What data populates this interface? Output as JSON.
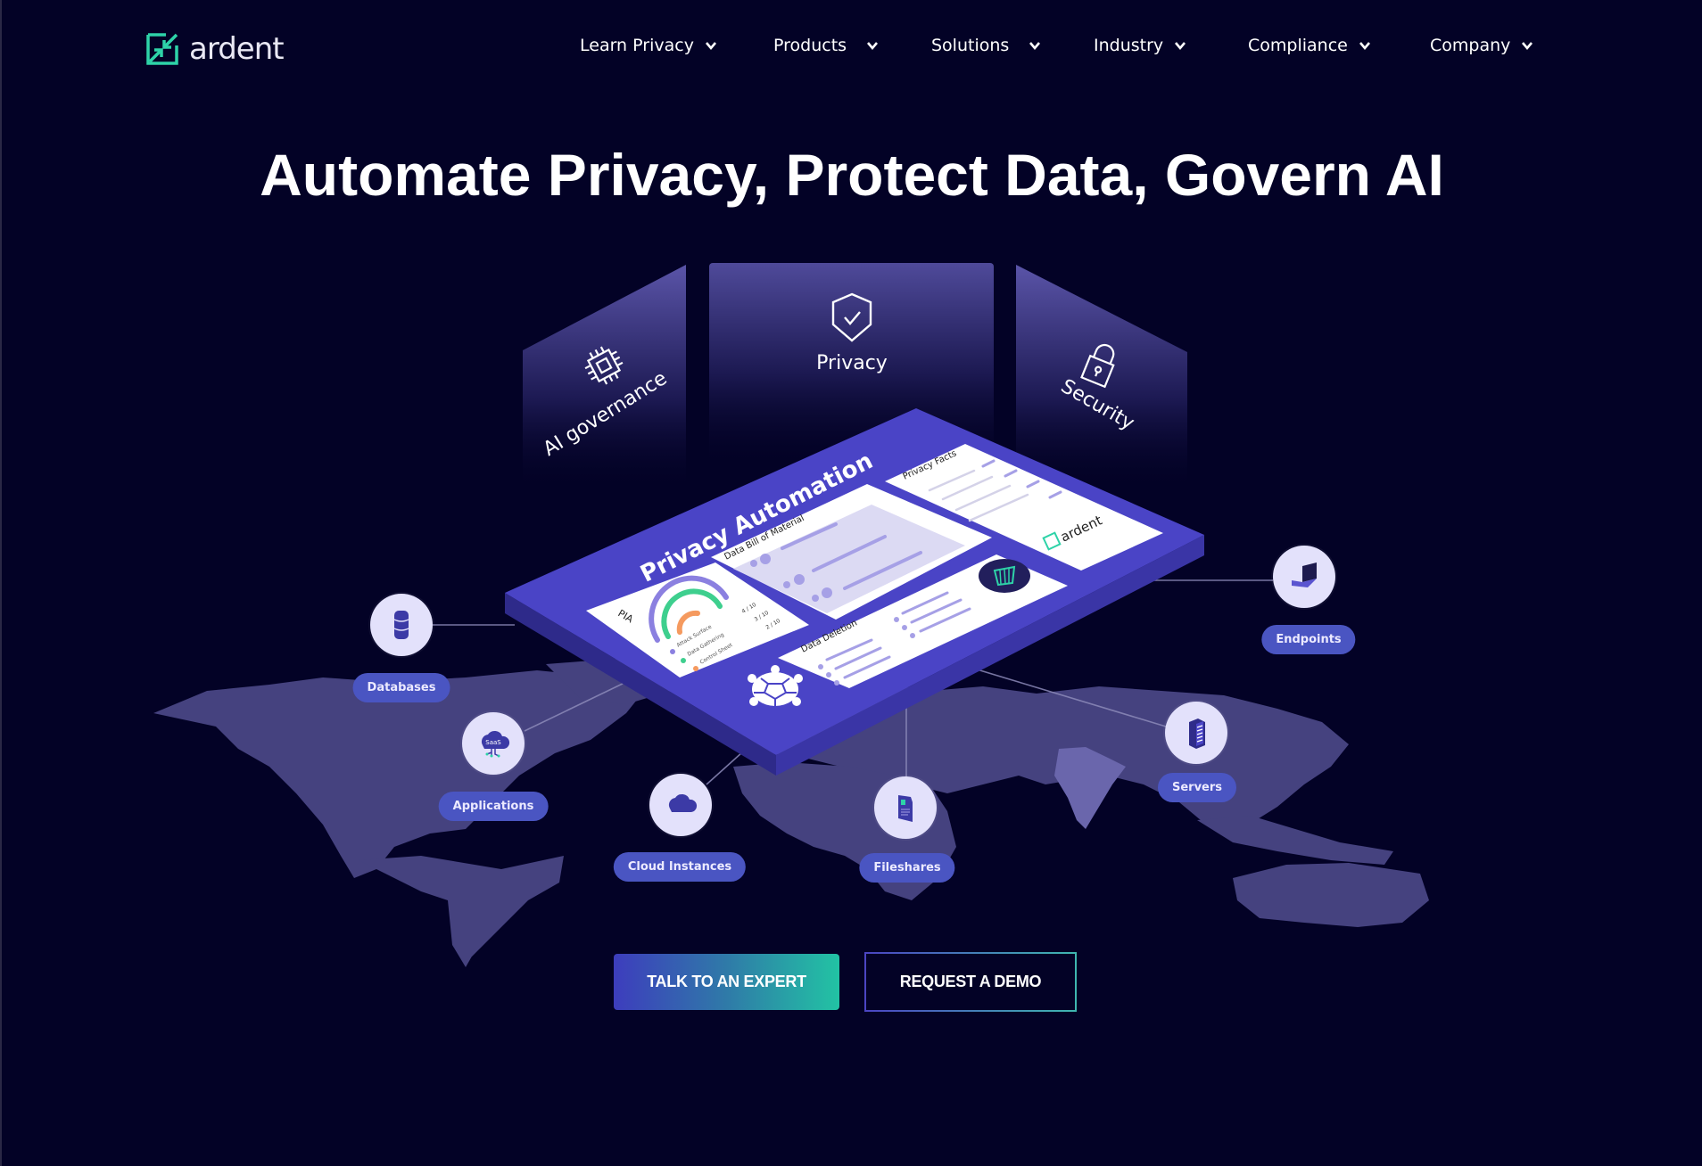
{
  "brand": {
    "name": "ardent",
    "logo_icon": "arrows-compress-square-icon",
    "accent_color": "#2ed3a8",
    "background_color": "#030226",
    "primary_purple": "#4741c4"
  },
  "nav": {
    "items": [
      {
        "label": "Learn Privacy",
        "icon": "chevron-down-icon"
      },
      {
        "label": "Products",
        "icon": "chevron-down-icon"
      },
      {
        "label": "Solutions",
        "icon": "chevron-down-icon"
      },
      {
        "label": "Industry",
        "icon": "chevron-down-icon"
      },
      {
        "label": "Compliance",
        "icon": "chevron-down-icon"
      },
      {
        "label": "Company",
        "icon": "chevron-down-icon"
      }
    ]
  },
  "hero": {
    "title": "Automate Privacy, Protect Data, Govern AI"
  },
  "illustration": {
    "panels": [
      {
        "label": "AI governance",
        "icon": "chip-icon"
      },
      {
        "label": "Privacy",
        "icon": "shield-check-icon"
      },
      {
        "label": "Security",
        "icon": "padlock-icon"
      }
    ],
    "platform": {
      "title": "Privacy Automation",
      "cards": {
        "pia": {
          "title": "PIA",
          "metrics": [
            {
              "label": "Attack Surface",
              "score": "4 / 10",
              "color": "#8b80e0"
            },
            {
              "label": "Data Gathering",
              "score": "3 / 10",
              "color": "#3ecf8e"
            },
            {
              "label": "Control Sheet",
              "score": "2 / 10",
              "color": "#f59a5f"
            }
          ]
        },
        "dbom": {
          "title": "Data Bill of Material"
        },
        "privacy_facts": {
          "title": "Privacy Facts",
          "logo": "ardent"
        },
        "data_deletion": {
          "title": "Data Deletion",
          "icon": "trash-icon"
        }
      },
      "mascot_icon": "turtle-icon"
    },
    "nodes": [
      {
        "label": "Databases",
        "icon": "database-icon"
      },
      {
        "label": "Applications",
        "icon": "saas-cloud-icon",
        "icon_text": "SaaS"
      },
      {
        "label": "Cloud Instances",
        "icon": "cloud-icon"
      },
      {
        "label": "Fileshares",
        "icon": "document-icon"
      },
      {
        "label": "Servers",
        "icon": "server-rack-icon"
      },
      {
        "label": "Endpoints",
        "icon": "laptop-icon"
      }
    ]
  },
  "cta": {
    "primary": "TALK TO AN EXPERT",
    "secondary": "REQUEST A DEMO"
  }
}
